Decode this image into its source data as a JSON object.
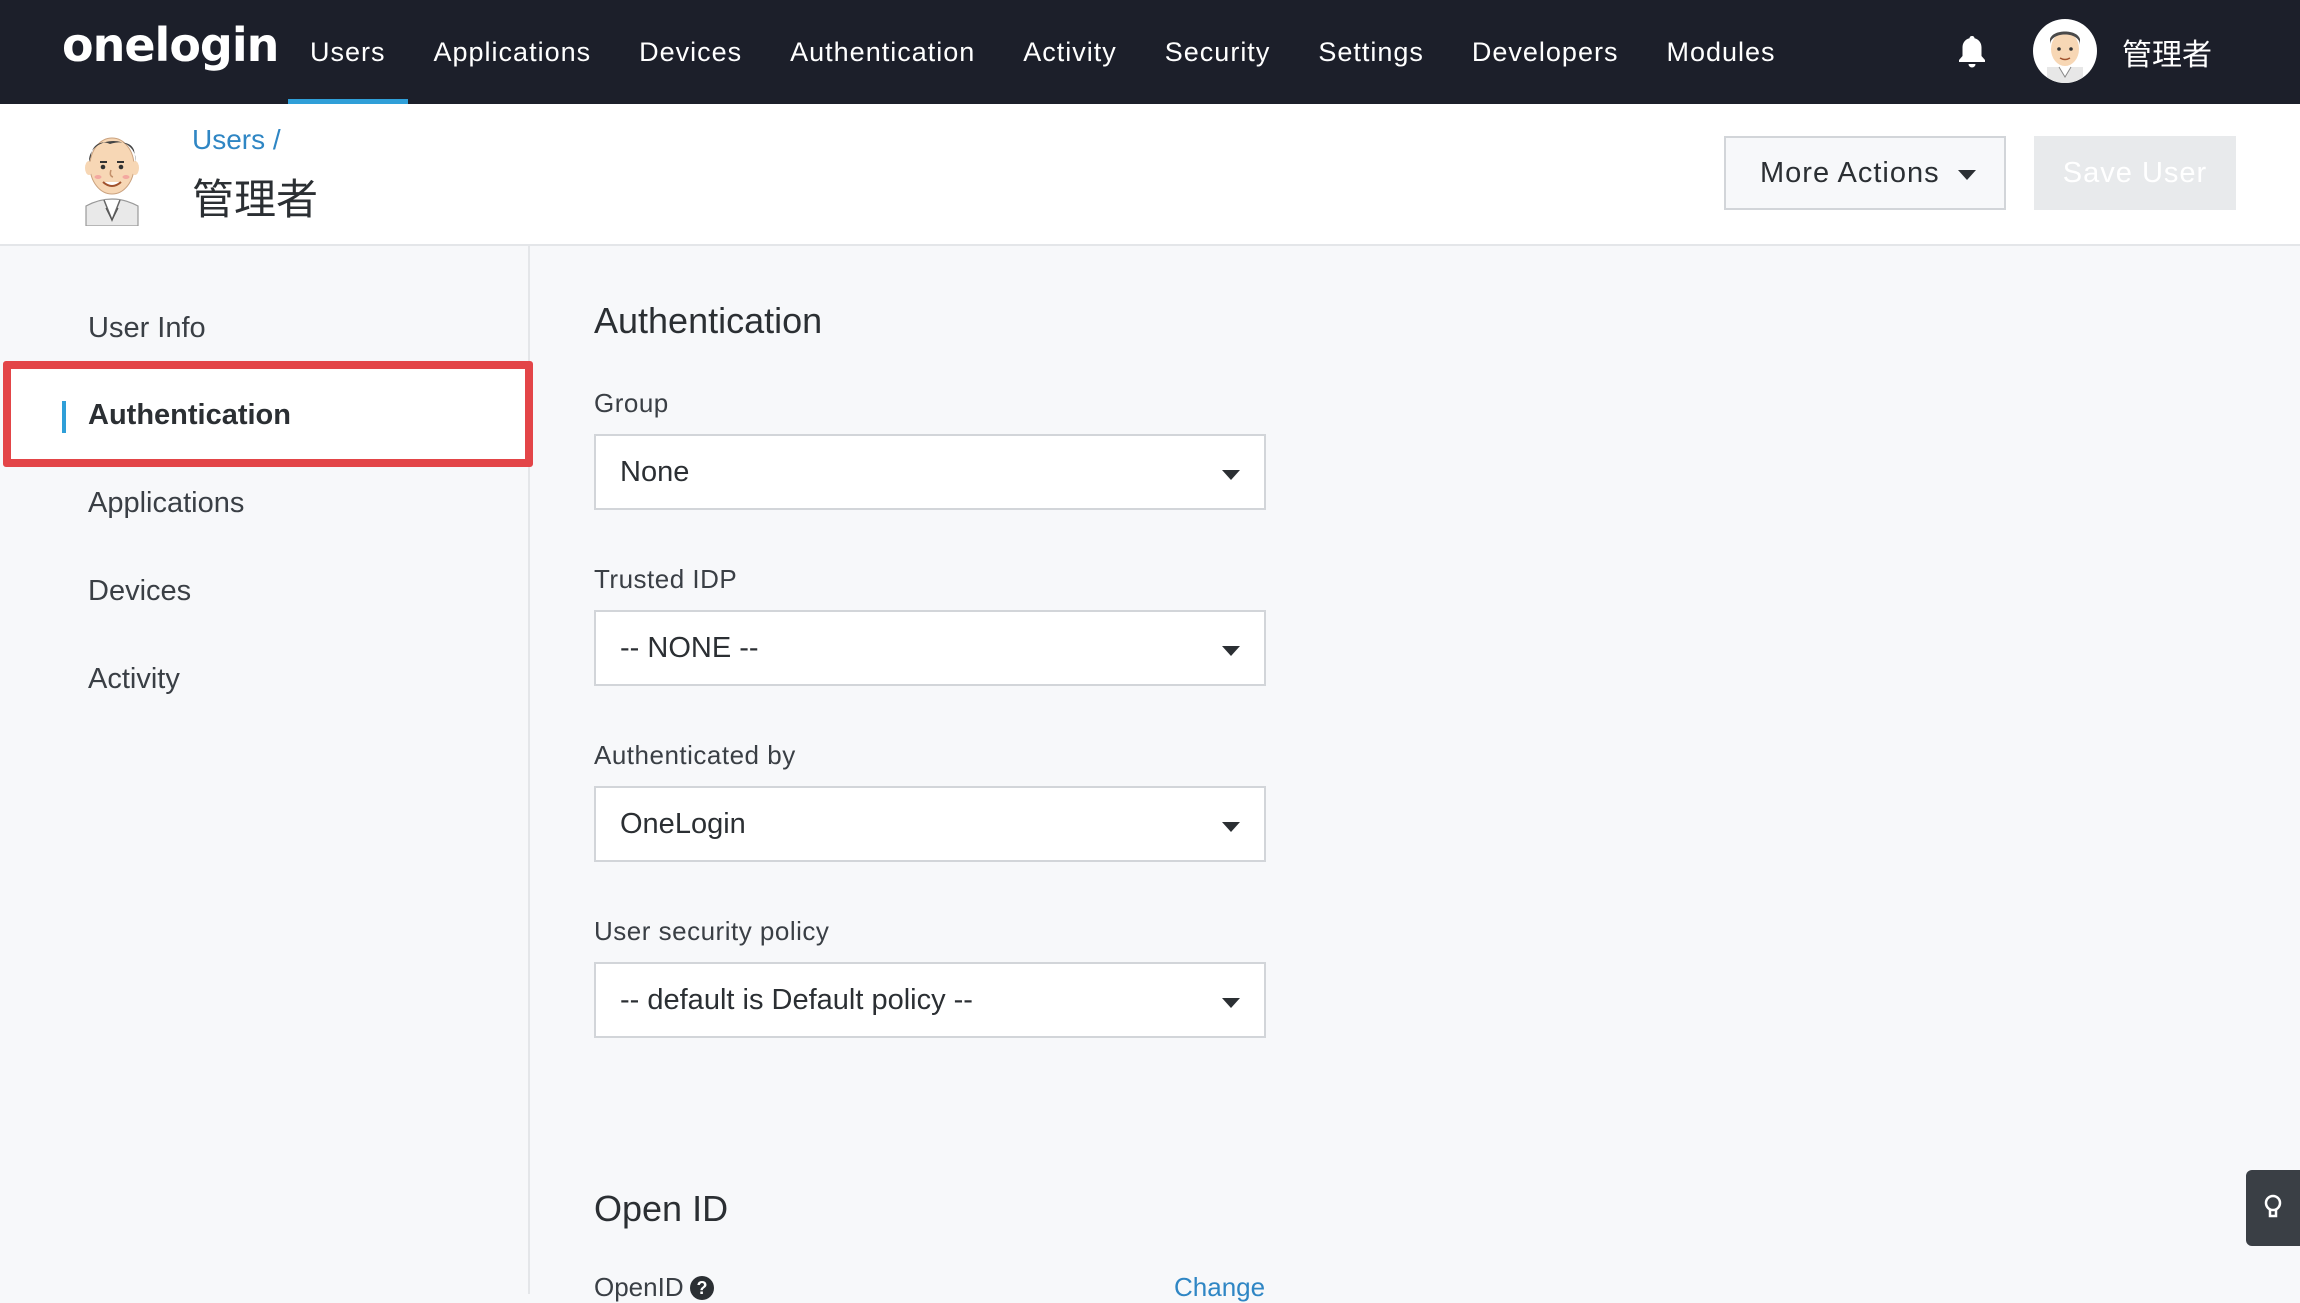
{
  "brand": {
    "logo": "onelogin",
    "accent": "#2f9fd8",
    "alert": "#e34548"
  },
  "nav": {
    "items": [
      {
        "label": "Users",
        "active": true
      },
      {
        "label": "Applications"
      },
      {
        "label": "Devices"
      },
      {
        "label": "Authentication"
      },
      {
        "label": "Activity"
      },
      {
        "label": "Security"
      },
      {
        "label": "Settings"
      },
      {
        "label": "Developers"
      },
      {
        "label": "Modules"
      }
    ],
    "notification_icon": "bell-icon",
    "username": "管理者"
  },
  "header": {
    "breadcrumb": "Users /",
    "title": "管理者",
    "more_actions": "More Actions",
    "save": "Save User"
  },
  "sidebar": {
    "items": [
      {
        "label": "User Info"
      },
      {
        "label": "Authentication",
        "active": true
      },
      {
        "label": "Applications"
      },
      {
        "label": "Devices"
      },
      {
        "label": "Activity"
      }
    ]
  },
  "main": {
    "section_title": "Authentication",
    "fields": [
      {
        "label": "Group",
        "value": "None"
      },
      {
        "label": "Trusted IDP",
        "value": "-- NONE --"
      },
      {
        "label": "Authenticated by",
        "value": "OneLogin"
      },
      {
        "label": "User security policy",
        "value": "-- default is Default policy --"
      }
    ],
    "openid_section_title": "Open ID",
    "openid_label": "OpenID",
    "change_link": "Change"
  },
  "floating": {
    "tip_icon": "lightbulb-icon"
  }
}
